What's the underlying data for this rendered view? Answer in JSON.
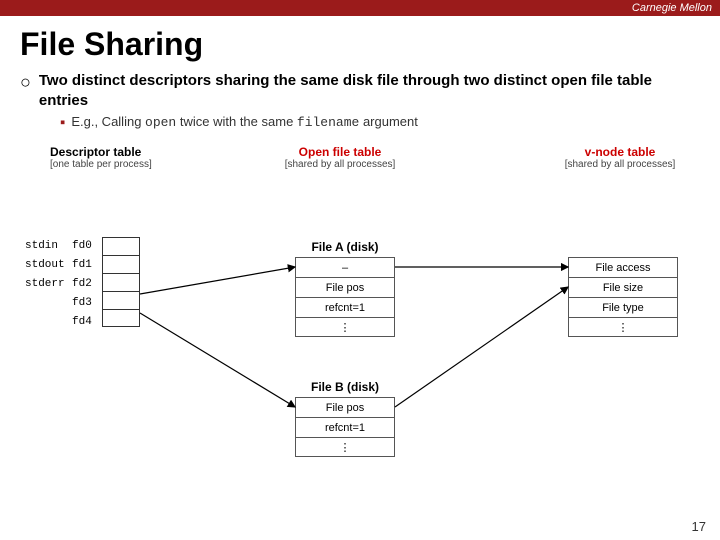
{
  "topbar": {
    "brand": "Carnegie Mellon"
  },
  "title": "File Sharing",
  "bullets": [
    {
      "text": "Two distinct descriptors sharing the same disk file through two distinct open file table entries"
    }
  ],
  "subbullet": "E.g., Calling open  twice with the same filename  argument",
  "diagram": {
    "col1_header": "Descriptor table",
    "col1_sub": "[one table per process]",
    "col2_header": "Open file table",
    "col2_sub": "[shared by all processes]",
    "col3_header": "v-node table",
    "col3_sub": "[shared by all processes]",
    "fd_labels": [
      "stdin",
      "stdout",
      "stderr",
      "",
      ""
    ],
    "fd_names": [
      "fd0",
      "fd1",
      "fd2",
      "fd3",
      "fd4"
    ],
    "file_a_label": "File A (disk)",
    "file_a_cells": [
      "–",
      "File pos",
      "refcnt=1",
      "⋮"
    ],
    "file_b_label": "File B (disk)",
    "file_b_cells": [
      "File pos",
      "refcnt=1",
      "⋮"
    ],
    "vnode_label": "",
    "vnode_cells": [
      "File access",
      "File size",
      "File type",
      "⋮"
    ]
  },
  "page_number": "17"
}
